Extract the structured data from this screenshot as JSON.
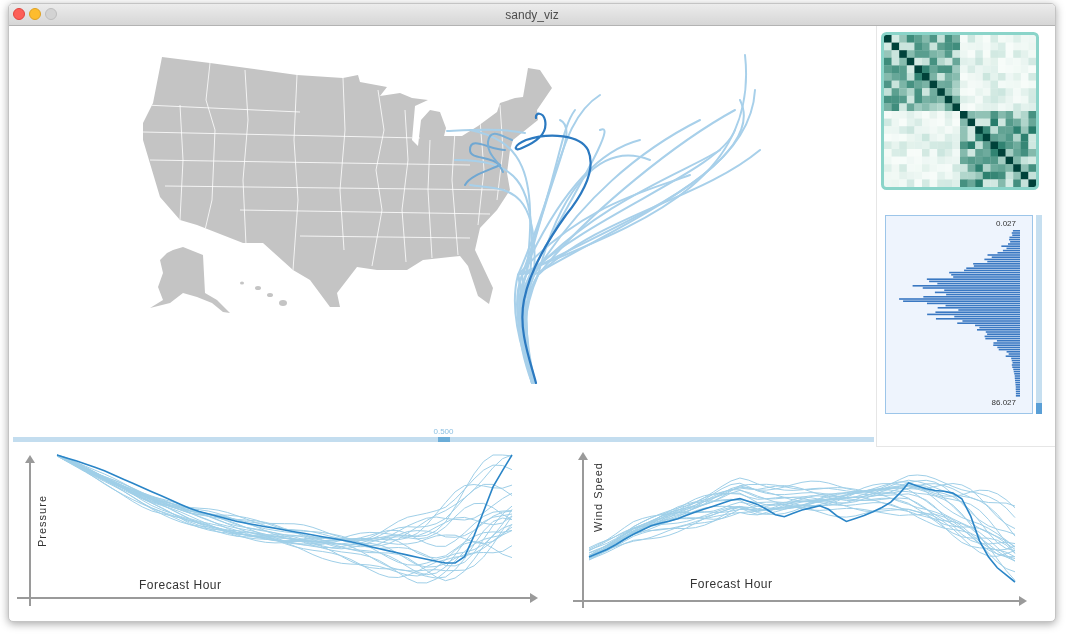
{
  "window": {
    "title": "sandy_viz",
    "zoom_disabled": true
  },
  "slider": {
    "reading": "0.500",
    "level": 0.5
  },
  "histogram": {
    "top_label": "0.027",
    "bottom_label": "86.027"
  },
  "charts": [
    {
      "kind": "pressure",
      "ylabel": "Pressure",
      "xlabel": "Forecast Hour"
    },
    {
      "kind": "wind_speed",
      "ylabel": "Wind Speed",
      "xlabel": "Forecast Hour"
    }
  ]
}
